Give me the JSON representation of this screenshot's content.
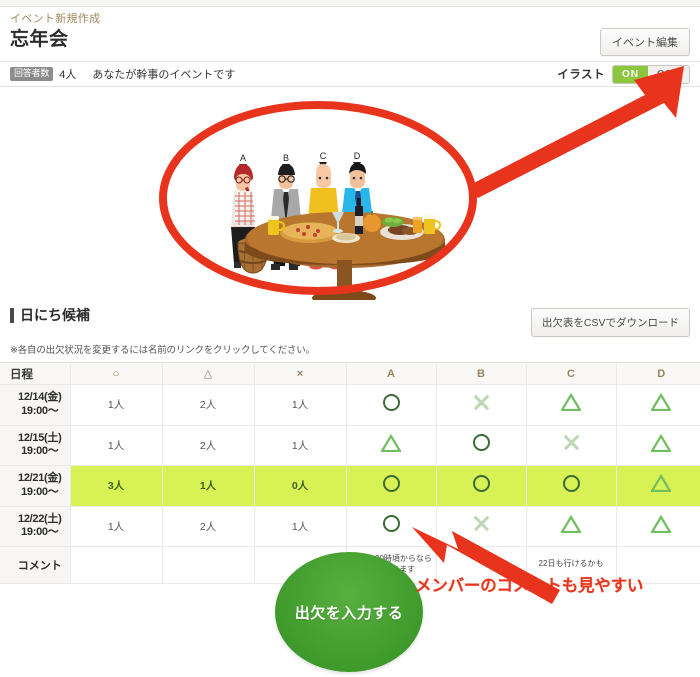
{
  "header": {
    "breadcrumb": "イベント新規作成",
    "event_title": "忘年会",
    "edit_button": "イベント編集",
    "respondent_badge": "回答者数",
    "respondent_count": "4人",
    "organizer_note": "あなたが幹事のイベントです",
    "illust_label": "イラスト",
    "toggle_on": "ON",
    "toggle_off": "OFF"
  },
  "illustration": {
    "member_tags": [
      "A",
      "B",
      "C",
      "D"
    ]
  },
  "section": {
    "title": "日にち候補",
    "note": "※各自の出欠状況を変更するには名前のリンクをクリックしてください。",
    "csv_button": "出欠表をCSVでダウンロード"
  },
  "table": {
    "headers": [
      "日程",
      "○",
      "△",
      "×",
      "A",
      "B",
      "C",
      "D"
    ],
    "rows": [
      {
        "date_line1": "12/14(金)",
        "date_line2": "19:00〜",
        "highlight": false,
        "counts": [
          "1人",
          "2人",
          "1人"
        ],
        "marks": [
          "circle",
          "cross",
          "triangle",
          "triangle"
        ]
      },
      {
        "date_line1": "12/15(土)",
        "date_line2": "19:00〜",
        "highlight": false,
        "counts": [
          "1人",
          "2人",
          "1人"
        ],
        "marks": [
          "triangle",
          "circle",
          "cross",
          "triangle"
        ]
      },
      {
        "date_line1": "12/21(金)",
        "date_line2": "19:00〜",
        "highlight": true,
        "counts": [
          "3人",
          "1人",
          "0人"
        ],
        "marks": [
          "circle",
          "circle",
          "circle",
          "triangle"
        ]
      },
      {
        "date_line1": "12/22(土)",
        "date_line2": "19:00〜",
        "highlight": false,
        "counts": [
          "1人",
          "2人",
          "1人"
        ],
        "marks": [
          "circle",
          "cross",
          "triangle",
          "triangle"
        ]
      }
    ],
    "comment_label": "コメント",
    "comments": [
      "15日も20時頃からなら\n参加できます",
      "",
      "22日も行けるかも",
      ""
    ]
  },
  "cta": {
    "label": "出欠を入力する"
  },
  "annotations": {
    "comment_callout": "メンバーのコメントも見やすい",
    "accent_red": "#e8341c",
    "accent_green": "#8cc63e"
  }
}
